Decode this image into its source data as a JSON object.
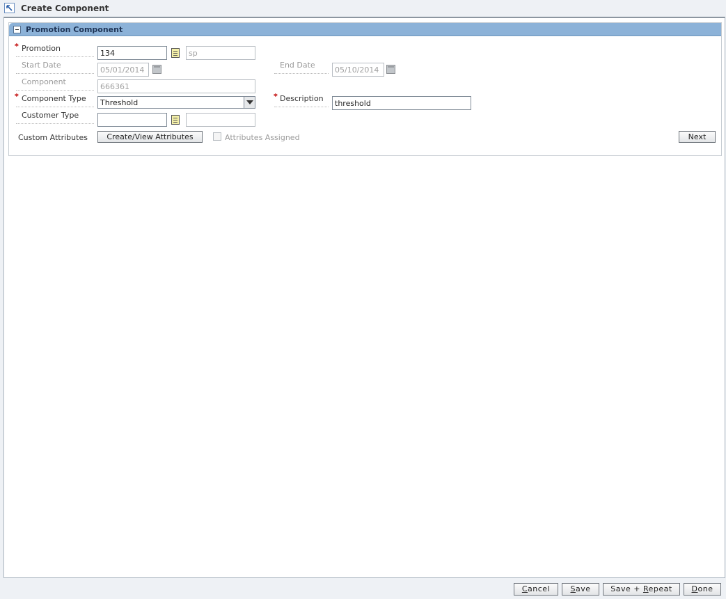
{
  "window": {
    "title": "Create Component"
  },
  "section": {
    "title": "Promotion Component"
  },
  "form": {
    "promotion": {
      "label": "Promotion",
      "value": "134",
      "desc": "sp"
    },
    "start_date": {
      "label": "Start Date",
      "value": "05/01/2014"
    },
    "end_date": {
      "label": "End Date",
      "value": "05/10/2014"
    },
    "component": {
      "label": "Component",
      "value": "666361"
    },
    "component_type": {
      "label": "Component Type",
      "value": "Threshold"
    },
    "description": {
      "label": "Description",
      "value": "threshold"
    },
    "customer_type": {
      "label": "Customer Type",
      "value": "",
      "desc": ""
    },
    "custom_attributes": {
      "label": "Custom Attributes",
      "button": "Create/View Attributes",
      "checkbox_label": "Attributes Assigned",
      "checked": false
    },
    "next_button": "Next"
  },
  "footer": {
    "cancel": {
      "accel": "C",
      "rest": "ancel"
    },
    "save": {
      "accel": "S",
      "rest": "ave"
    },
    "save_repeat": {
      "pre": "Save + ",
      "accel": "R",
      "rest": "epeat"
    },
    "done": {
      "accel": "D",
      "rest": "one"
    }
  },
  "icons": {
    "window": "create-component-icon",
    "collapse": "collapse-icon",
    "lov": "list-of-values-icon",
    "calendar": "calendar-icon",
    "dropdown": "chevron-down-icon"
  },
  "colors": {
    "section_header": "#8cb2d8",
    "required": "#c00000"
  }
}
